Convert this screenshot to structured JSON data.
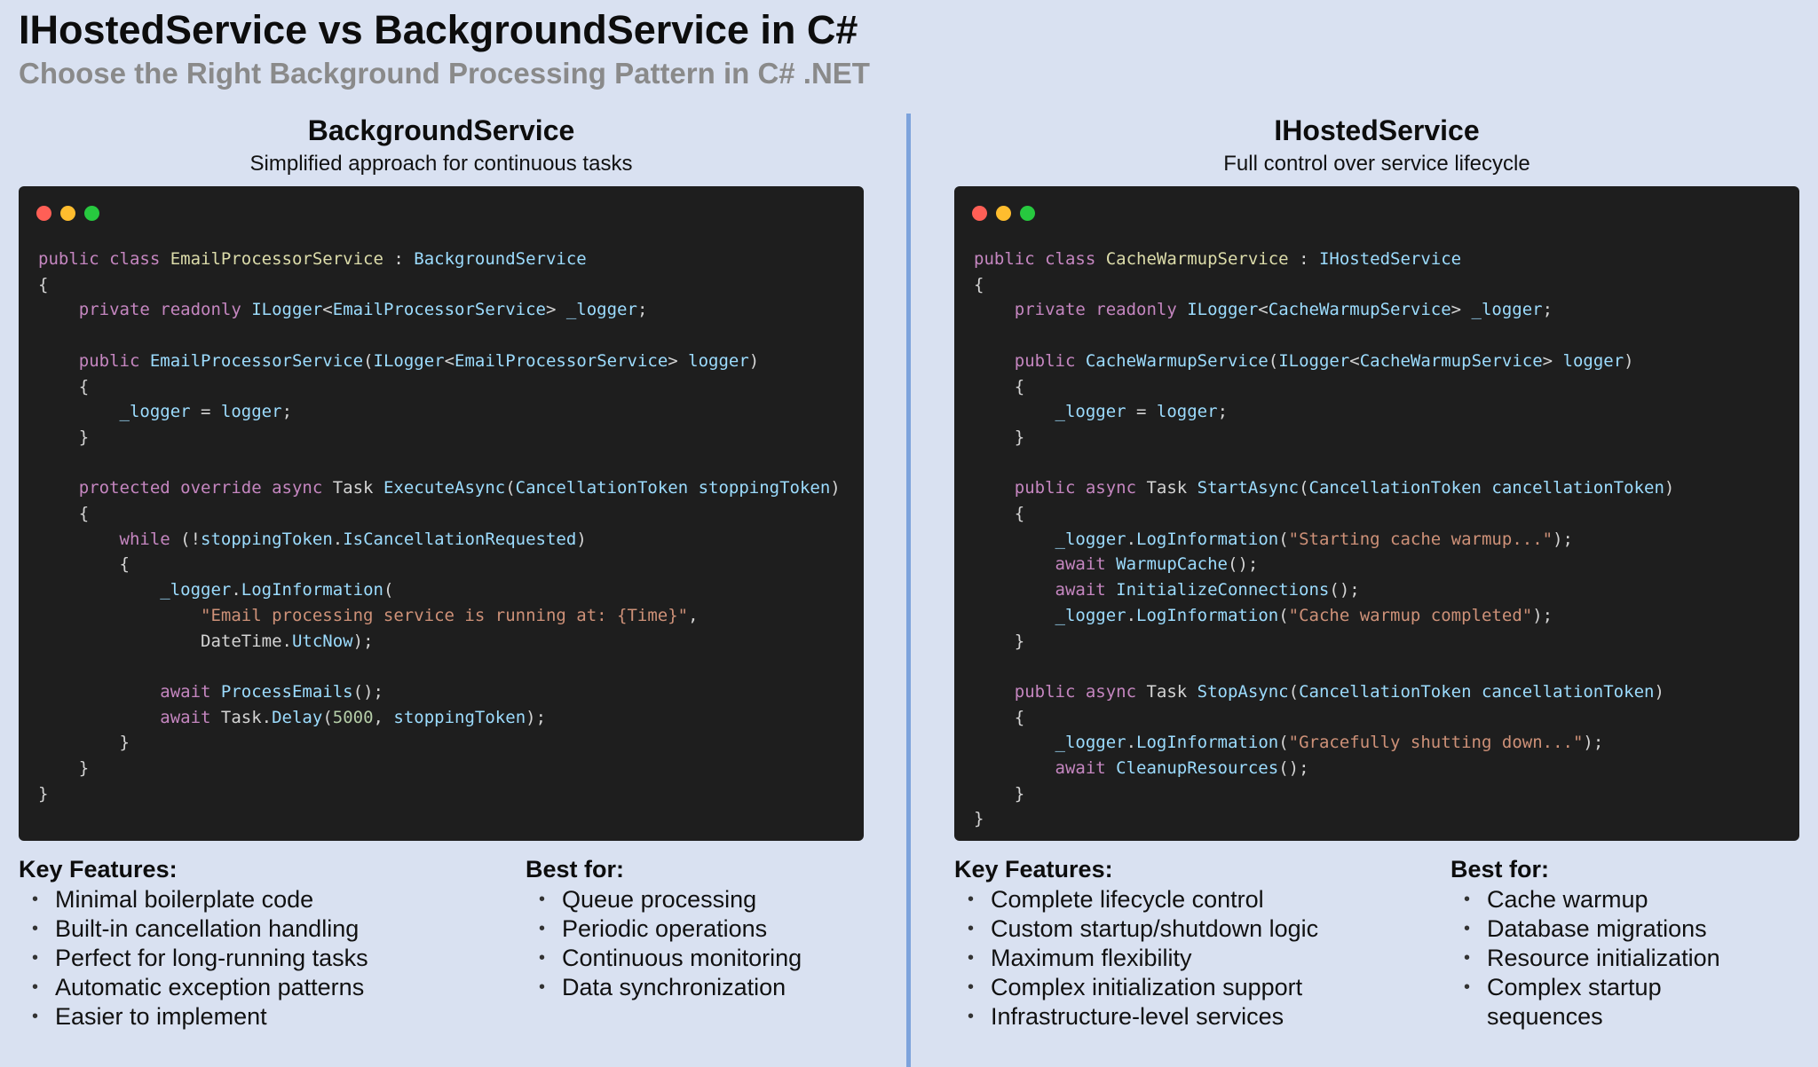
{
  "title": "IHostedService vs BackgroundService in C#",
  "subtitle": "Choose the Right Background Processing Pattern in C# .NET",
  "colors": {
    "background": "#d9e1f1",
    "divider": "#7da3dc",
    "code_bg": "#1e1e1e",
    "dot_red": "#ff5f56",
    "dot_yellow": "#ffbd2e",
    "dot_green": "#27c93f"
  },
  "left": {
    "heading": "BackgroundService",
    "description": "Simplified approach for continuous tasks",
    "key_features_title": "Key Features:",
    "key_features": [
      "Minimal boilerplate code",
      "Built-in cancellation handling",
      "Perfect for long-running tasks",
      "Automatic exception patterns",
      "Easier to implement"
    ],
    "best_for_title": "Best for:",
    "best_for": [
      "Queue processing",
      "Periodic operations",
      "Continuous monitoring",
      "Data synchronization"
    ]
  },
  "right": {
    "heading": "IHostedService",
    "description": "Full control over service lifecycle",
    "key_features_title": "Key Features:",
    "key_features": [
      "Complete lifecycle control",
      "Custom startup/shutdown logic",
      "Maximum flexibility",
      "Complex initialization support",
      "Infrastructure-level services"
    ],
    "best_for_title": "Best for:",
    "best_for": [
      "Cache warmup",
      "Database migrations",
      "Resource initialization",
      "Complex startup sequences"
    ]
  },
  "code_left": {
    "lines": [
      [
        [
          "k",
          "public class "
        ],
        [
          "c",
          "EmailProcessorService"
        ],
        [
          "p",
          " : "
        ],
        [
          "t",
          "BackgroundService"
        ]
      ],
      [
        [
          "p",
          "{"
        ]
      ],
      [
        [
          "k",
          "    private readonly "
        ],
        [
          "t",
          "ILogger"
        ],
        [
          "p",
          "<"
        ],
        [
          "t",
          "EmailProcessorService"
        ],
        [
          "p",
          "> "
        ],
        [
          "t",
          "_logger"
        ],
        [
          "p",
          ";"
        ]
      ],
      [],
      [
        [
          "k",
          "    public "
        ],
        [
          "t",
          "EmailProcessorService"
        ],
        [
          "p",
          "("
        ],
        [
          "t",
          "ILogger"
        ],
        [
          "p",
          "<"
        ],
        [
          "t",
          "EmailProcessorService"
        ],
        [
          "p",
          "> "
        ],
        [
          "t",
          "logger"
        ],
        [
          "p",
          ")"
        ]
      ],
      [
        [
          "p",
          "    {"
        ]
      ],
      [
        [
          "t",
          "        _logger"
        ],
        [
          "p",
          " = "
        ],
        [
          "t",
          "logger"
        ],
        [
          "p",
          ";"
        ]
      ],
      [
        [
          "p",
          "    }"
        ]
      ],
      [],
      [
        [
          "k",
          "    protected override async "
        ],
        [
          "p",
          "Task "
        ],
        [
          "t",
          "ExecuteAsync"
        ],
        [
          "p",
          "("
        ],
        [
          "t",
          "CancellationToken stoppingToken"
        ],
        [
          "p",
          ")"
        ]
      ],
      [
        [
          "p",
          "    {"
        ]
      ],
      [
        [
          "k",
          "        while "
        ],
        [
          "p",
          "(!"
        ],
        [
          "t",
          "stoppingToken"
        ],
        [
          "p",
          "."
        ],
        [
          "t",
          "IsCancellationRequested"
        ],
        [
          "p",
          ")"
        ]
      ],
      [
        [
          "p",
          "        {"
        ]
      ],
      [
        [
          "t",
          "            _logger"
        ],
        [
          "p",
          "."
        ],
        [
          "t",
          "LogInformation"
        ],
        [
          "p",
          "("
        ]
      ],
      [
        [
          "s2",
          "                \"Email processing service is running at: {Time}\""
        ],
        [
          "p",
          ","
        ]
      ],
      [
        [
          "p",
          "                DateTime."
        ],
        [
          "t",
          "UtcNow"
        ],
        [
          "p",
          ");"
        ]
      ],
      [],
      [
        [
          "k",
          "            await "
        ],
        [
          "t",
          "ProcessEmails"
        ],
        [
          "p",
          "();"
        ]
      ],
      [
        [
          "k",
          "            await "
        ],
        [
          "p",
          "Task."
        ],
        [
          "t",
          "Delay"
        ],
        [
          "p",
          "("
        ],
        [
          "n",
          "5000"
        ],
        [
          "p",
          ", "
        ],
        [
          "t",
          "stoppingToken"
        ],
        [
          "p",
          ");"
        ]
      ],
      [
        [
          "p",
          "        }"
        ]
      ],
      [
        [
          "p",
          "    }"
        ]
      ],
      [
        [
          "p",
          "}"
        ]
      ]
    ]
  },
  "code_right": {
    "lines": [
      [
        [
          "k",
          "public class "
        ],
        [
          "c",
          "CacheWarmupService"
        ],
        [
          "p",
          " : "
        ],
        [
          "t",
          "IHostedService"
        ]
      ],
      [
        [
          "p",
          "{"
        ]
      ],
      [
        [
          "k",
          "    private readonly "
        ],
        [
          "t",
          "ILogger"
        ],
        [
          "p",
          "<"
        ],
        [
          "t",
          "CacheWarmupService"
        ],
        [
          "p",
          "> "
        ],
        [
          "t",
          "_logger"
        ],
        [
          "p",
          ";"
        ]
      ],
      [],
      [
        [
          "k",
          "    public "
        ],
        [
          "t",
          "CacheWarmupService"
        ],
        [
          "p",
          "("
        ],
        [
          "t",
          "ILogger"
        ],
        [
          "p",
          "<"
        ],
        [
          "t",
          "CacheWarmupService"
        ],
        [
          "p",
          "> "
        ],
        [
          "t",
          "logger"
        ],
        [
          "p",
          ")"
        ]
      ],
      [
        [
          "p",
          "    {"
        ]
      ],
      [
        [
          "t",
          "        _logger"
        ],
        [
          "p",
          " = "
        ],
        [
          "t",
          "logger"
        ],
        [
          "p",
          ";"
        ]
      ],
      [
        [
          "p",
          "    }"
        ]
      ],
      [],
      [
        [
          "k",
          "    public async "
        ],
        [
          "p",
          "Task "
        ],
        [
          "t",
          "StartAsync"
        ],
        [
          "p",
          "("
        ],
        [
          "t",
          "CancellationToken cancellationToken"
        ],
        [
          "p",
          ")"
        ]
      ],
      [
        [
          "p",
          "    {"
        ]
      ],
      [
        [
          "t",
          "        _logger"
        ],
        [
          "p",
          "."
        ],
        [
          "t",
          "LogInformation"
        ],
        [
          "p",
          "("
        ],
        [
          "s2",
          "\"Starting cache warmup...\""
        ],
        [
          "p",
          ");"
        ]
      ],
      [
        [
          "k",
          "        await "
        ],
        [
          "t",
          "WarmupCache"
        ],
        [
          "p",
          "();"
        ]
      ],
      [
        [
          "k",
          "        await "
        ],
        [
          "t",
          "InitializeConnections"
        ],
        [
          "p",
          "();"
        ]
      ],
      [
        [
          "t",
          "        _logger"
        ],
        [
          "p",
          "."
        ],
        [
          "t",
          "LogInformation"
        ],
        [
          "p",
          "("
        ],
        [
          "s2",
          "\"Cache warmup completed\""
        ],
        [
          "p",
          ");"
        ]
      ],
      [
        [
          "p",
          "    }"
        ]
      ],
      [],
      [
        [
          "k",
          "    public async "
        ],
        [
          "p",
          "Task "
        ],
        [
          "t",
          "StopAsync"
        ],
        [
          "p",
          "("
        ],
        [
          "t",
          "CancellationToken cancellationToken"
        ],
        [
          "p",
          ")"
        ]
      ],
      [
        [
          "p",
          "    {"
        ]
      ],
      [
        [
          "t",
          "        _logger"
        ],
        [
          "p",
          "."
        ],
        [
          "t",
          "LogInformation"
        ],
        [
          "p",
          "("
        ],
        [
          "s2",
          "\"Gracefully shutting down...\""
        ],
        [
          "p",
          ");"
        ]
      ],
      [
        [
          "k",
          "        await "
        ],
        [
          "t",
          "CleanupResources"
        ],
        [
          "p",
          "();"
        ]
      ],
      [
        [
          "p",
          "    }"
        ]
      ],
      [
        [
          "p",
          "}"
        ]
      ]
    ]
  }
}
